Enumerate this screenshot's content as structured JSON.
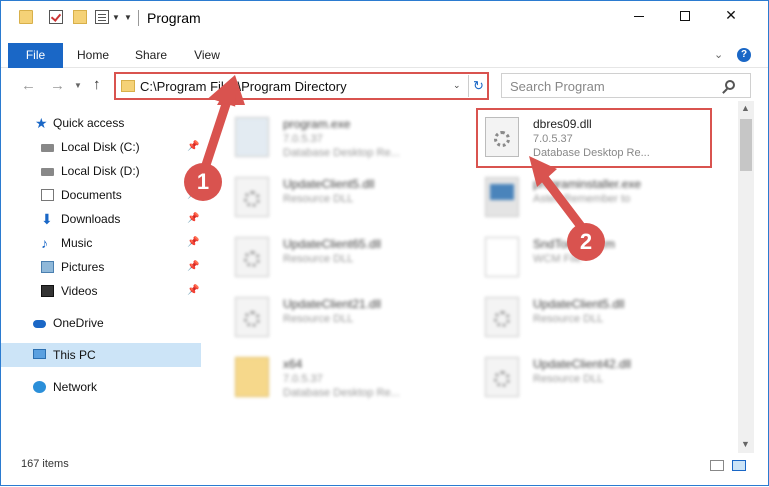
{
  "window": {
    "title": "Program"
  },
  "ribbon": {
    "tabs": [
      "File",
      "Home",
      "Share",
      "View"
    ],
    "help_label": "?"
  },
  "address": {
    "path": "C:\\Program Files\\Program Directory",
    "search_placeholder": "Search Program"
  },
  "sidebar": {
    "items": [
      {
        "label": "Quick access",
        "icon": "star-icon",
        "pinned": false
      },
      {
        "label": "Local Disk (C:)",
        "icon": "drive-icon",
        "pinned": true
      },
      {
        "label": "Local Disk (D:)",
        "icon": "drive-icon",
        "pinned": false
      },
      {
        "label": "Documents",
        "icon": "documents-icon",
        "pinned": true
      },
      {
        "label": "Downloads",
        "icon": "downloads-icon",
        "pinned": true
      },
      {
        "label": "Music",
        "icon": "music-icon",
        "pinned": true
      },
      {
        "label": "Pictures",
        "icon": "pictures-icon",
        "pinned": true
      },
      {
        "label": "Videos",
        "icon": "videos-icon",
        "pinned": true
      },
      {
        "label": "OneDrive",
        "icon": "onedrive-icon",
        "pinned": false
      },
      {
        "label": "This PC",
        "icon": "pc-icon",
        "pinned": false,
        "selected": true
      },
      {
        "label": "Network",
        "icon": "network-icon",
        "pinned": false
      }
    ]
  },
  "files": [
    {
      "name": "program.exe",
      "line1": "7.0.5.37",
      "line2": "Database Desktop Re...",
      "icon": "exe-icon",
      "blurred": true
    },
    {
      "name": "dbres09.dll",
      "line1": "7.0.5.37",
      "line2": "Database Desktop Re...",
      "icon": "dll-icon",
      "blurred": false
    },
    {
      "name": "UpdateClient5.dll",
      "line1": "Resource DLL",
      "line2": "",
      "icon": "dll-icon",
      "blurred": true
    },
    {
      "name": "programinstaller.exe",
      "line1": "Astek Remember to",
      "line2": "",
      "icon": "installer-icon",
      "blurred": true
    },
    {
      "name": "UpdateClient65.dll",
      "line1": "Resource DLL",
      "line2": "",
      "icon": "dll-icon",
      "blurred": true
    },
    {
      "name": "SndTod... .wcm",
      "line1": "WCM File",
      "line2": "",
      "icon": "wcm-icon",
      "blurred": true
    },
    {
      "name": "UpdateClient21.dll",
      "line1": "Resource DLL",
      "line2": "",
      "icon": "dll-icon",
      "blurred": true
    },
    {
      "name": "UpdateClient5.dll",
      "line1": "Resource DLL",
      "line2": "",
      "icon": "dll-icon",
      "blurred": true
    },
    {
      "name": "x64",
      "line1": "7.0.5.37",
      "line2": "Database Desktop Re...",
      "icon": "folder-icon",
      "blurred": true
    },
    {
      "name": "UpdateClient42.dll",
      "line1": "Resource DLL",
      "line2": "",
      "icon": "dll-icon",
      "blurred": true
    }
  ],
  "status": {
    "item_count": "167 items"
  },
  "annotations": {
    "step1": "1",
    "step2": "2",
    "color": "#d9534f"
  },
  "colors": {
    "accent": "#1a67c6",
    "highlight": "#d9534f",
    "selection": "#cce4f7"
  }
}
